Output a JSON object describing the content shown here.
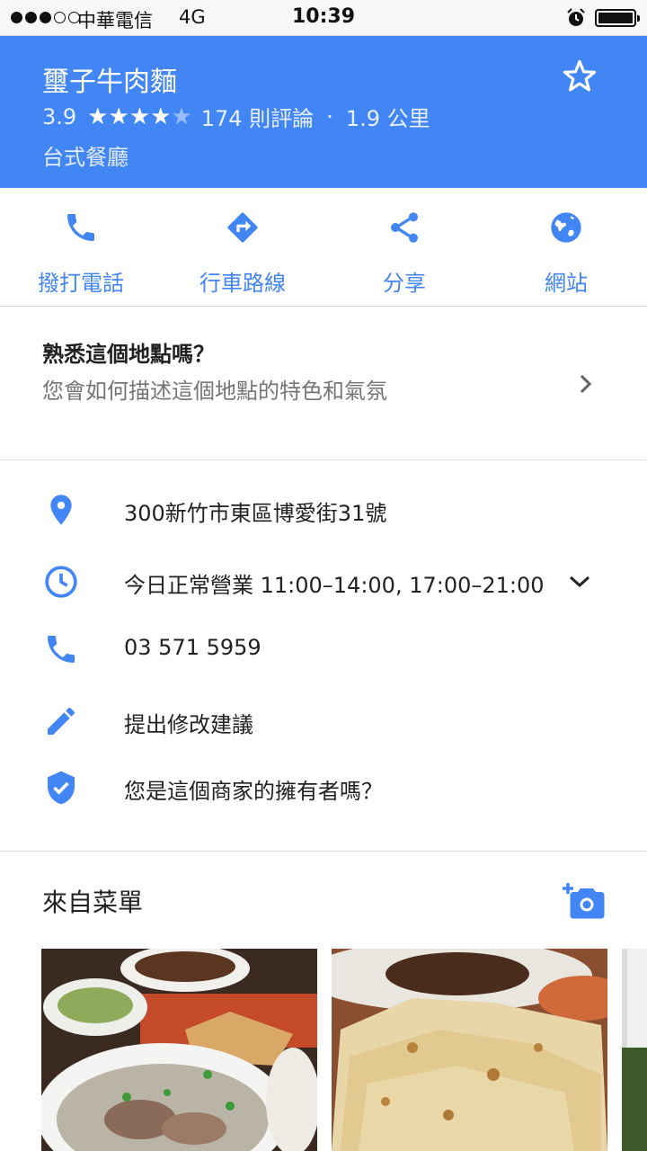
{
  "status_bar": {
    "carrier": "中華電信",
    "network": "4G",
    "time": "10:39"
  },
  "place": {
    "name": "璽子牛肉麵",
    "rating": "3.9",
    "rating_stars": 3.9,
    "reviews": "174 則評論",
    "separator": "·",
    "distance": "1.9 公里",
    "category": "台式餐廳"
  },
  "actions": [
    {
      "label": "撥打電話",
      "icon": "phone-icon"
    },
    {
      "label": "行車路線",
      "icon": "directions-icon"
    },
    {
      "label": "分享",
      "icon": "share-icon"
    },
    {
      "label": "網站",
      "icon": "globe-icon"
    }
  ],
  "familiar": {
    "title": "熟悉這個地點嗎？",
    "subtitle": "您會如何描述這個地點的特色和氣氛"
  },
  "info": {
    "address": "300新竹市東區博愛街31號",
    "hours": "今日正常營業 11:00–14:00, 17:00–21:00",
    "phone": "03 571 5959",
    "suggest_edit": "提出修改建議",
    "claim_business": "您是這個商家的擁有者嗎？"
  },
  "menu": {
    "title": "來自菜單"
  },
  "colors": {
    "accent": "#4285f4",
    "text": "#212121",
    "secondary_text": "#757575"
  }
}
